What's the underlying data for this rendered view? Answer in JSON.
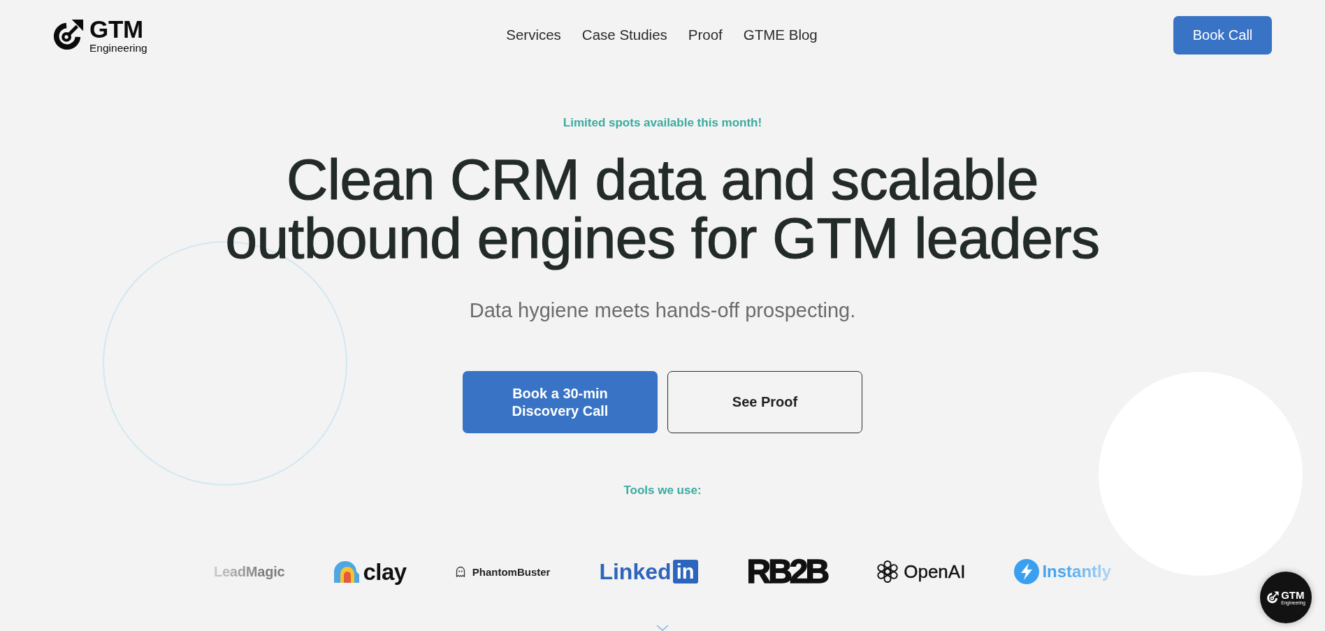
{
  "header": {
    "logo": {
      "title": "GTM",
      "subtitle": "Engineering"
    },
    "nav": [
      {
        "label": "Services"
      },
      {
        "label": "Case Studies"
      },
      {
        "label": "Proof"
      },
      {
        "label": "GTME Blog"
      }
    ],
    "cta": {
      "label": "Book Call"
    }
  },
  "hero": {
    "eyebrow": "Limited spots available this month!",
    "title": "Clean CRM data and scalable outbound engines for GTM leaders",
    "subtitle": "Data hygiene meets hands-off prospecting.",
    "buttons": [
      {
        "kind": "primary",
        "label": "Book a 30-min Discovery Call"
      },
      {
        "kind": "outline",
        "label": "See Proof"
      }
    ]
  },
  "tools": {
    "heading": "Tools we use:",
    "logos": [
      {
        "kind": "plain",
        "name": "LeadMagic"
      },
      {
        "kind": "arch",
        "name": "clay"
      },
      {
        "kind": "ghost",
        "name": "PhantomBuster"
      },
      {
        "kind": "tile",
        "name": "Linked",
        "tile": "in"
      },
      {
        "kind": "heavy",
        "name": "RB2B"
      },
      {
        "kind": "knot",
        "name": "OpenAI"
      },
      {
        "kind": "bolt",
        "name": "Instantly"
      }
    ]
  },
  "floating_badge": {
    "title": "GTM",
    "subtitle": "Engineering"
  }
}
